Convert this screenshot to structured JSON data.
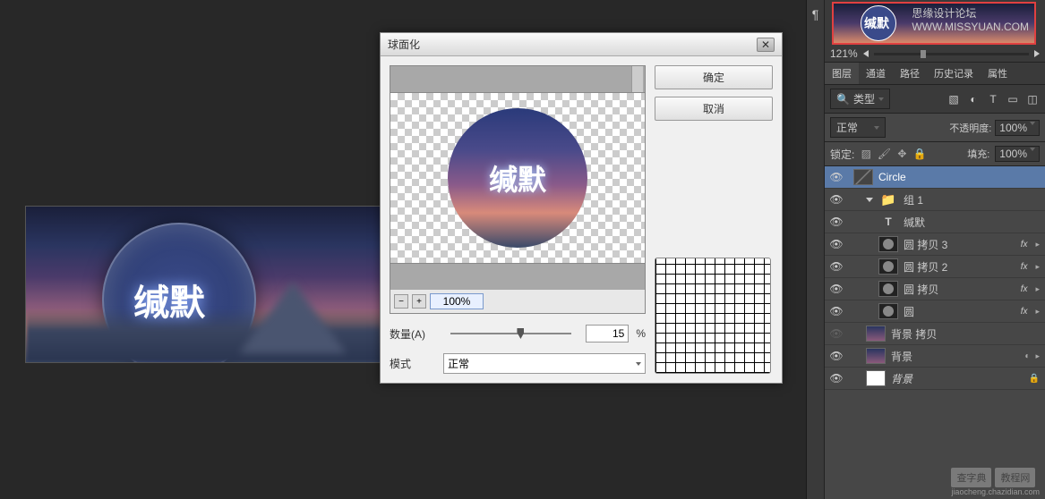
{
  "canvas": {
    "text": "缄默"
  },
  "dialog": {
    "title": "球面化",
    "ok": "确定",
    "cancel": "取消",
    "zoom": "100%",
    "preview_text": "缄默",
    "amount_label": "数量(A)",
    "amount_value": "15",
    "amount_suffix": "%",
    "mode_label": "模式",
    "mode_value": "正常"
  },
  "navigator": {
    "zoom": "121%",
    "thumb_text": "缄默",
    "watermark_1": "思缘设计论坛",
    "watermark_2": "WWW.MISSYUAN.COM"
  },
  "tabs": [
    "图层",
    "通道",
    "路径",
    "历史记录",
    "属性"
  ],
  "filter": {
    "kind": "类型"
  },
  "blend": {
    "mode": "正常",
    "opacity_label": "不透明度:",
    "opacity_value": "100%"
  },
  "lock": {
    "label": "锁定:",
    "fill_label": "填充:",
    "fill_value": "100%"
  },
  "layers": [
    {
      "vis": true,
      "type": "so",
      "name": "Circle",
      "selected": true,
      "indent": 0
    },
    {
      "vis": true,
      "type": "folder",
      "name": "组 1",
      "indent": 1
    },
    {
      "vis": true,
      "type": "text",
      "name": "缄默",
      "indent": 2
    },
    {
      "vis": true,
      "type": "circle",
      "name": "圆 拷贝 3",
      "fx": true,
      "indent": 2
    },
    {
      "vis": true,
      "type": "circle",
      "name": "圆 拷贝 2",
      "fx": true,
      "indent": 2
    },
    {
      "vis": true,
      "type": "circle",
      "name": "圆 拷贝",
      "fx": true,
      "indent": 2
    },
    {
      "vis": true,
      "type": "circle",
      "name": "圆",
      "fx": true,
      "indent": 2
    },
    {
      "vis": false,
      "type": "bg",
      "name": "背景 拷贝",
      "indent": 1
    },
    {
      "vis": true,
      "type": "bg",
      "name": "背景",
      "smart": true,
      "indent": 1
    },
    {
      "vis": true,
      "type": "white",
      "name": "背景",
      "lock": true,
      "italic": true,
      "indent": 1
    }
  ],
  "watermark": {
    "a": "查字典",
    "b": "教程网",
    "url": "jiaocheng.chazidian.com"
  }
}
